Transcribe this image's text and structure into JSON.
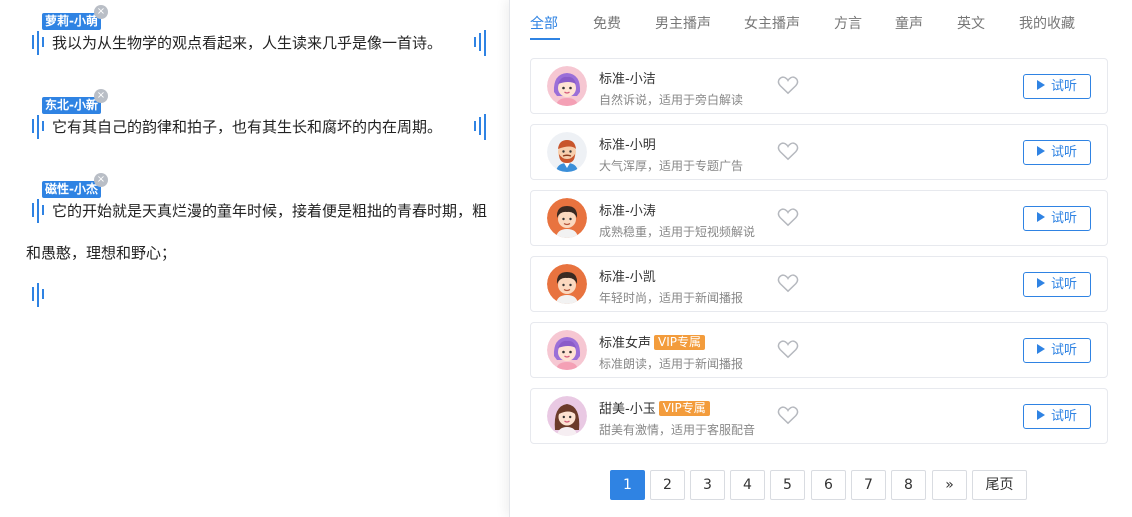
{
  "editor": {
    "paragraphs": [
      {
        "voice_tag": "萝莉-小萌",
        "text": "我以为从生物学的观点看起来，人生读来几乎是像一首诗。"
      },
      {
        "voice_tag": "东北-小新",
        "text": "它有其自己的韵律和拍子，也有其生长和腐坏的内在周期。"
      },
      {
        "voice_tag": "磁性-小杰",
        "text": "它的开始就是天真烂漫的童年时候，接着便是粗拙的青春时期，粗"
      }
    ],
    "continuation": "和愚憨，理想和野心；",
    "remove_glyph": "×"
  },
  "voice_panel": {
    "tabs": [
      {
        "label": "全部",
        "active": true
      },
      {
        "label": "免费"
      },
      {
        "label": "男主播声"
      },
      {
        "label": "女主播声"
      },
      {
        "label": "方言"
      },
      {
        "label": "童声"
      },
      {
        "label": "英文"
      },
      {
        "label": "我的收藏"
      }
    ],
    "try_label": "试听",
    "voices": [
      {
        "name": "标准-小洁",
        "desc": "自然诉说，适用于旁白解读",
        "avatar": "girl-avatar",
        "badge": ""
      },
      {
        "name": "标准-小明",
        "desc": "大气浑厚，适用于专题广告",
        "avatar": "bearded-man-avatar",
        "badge": ""
      },
      {
        "name": "标准-小涛",
        "desc": "成熟稳重，适用于短视频解说",
        "avatar": "man-avatar",
        "badge": ""
      },
      {
        "name": "标准-小凯",
        "desc": "年轻时尚，适用于新闻播报",
        "avatar": "man-avatar",
        "badge": ""
      },
      {
        "name": "标准女声",
        "desc": "标准朗读，适用于新闻播报",
        "avatar": "girl-avatar",
        "badge": "VIP专属"
      },
      {
        "name": "甜美-小玉",
        "desc": "甜美有激情，适用于客服配音",
        "avatar": "woman-avatar",
        "badge": "VIP专属"
      }
    ],
    "pagination": {
      "pages": [
        "1",
        "2",
        "3",
        "4",
        "5",
        "6",
        "7",
        "8"
      ],
      "current": "1",
      "next": "»",
      "last": "尾页"
    }
  },
  "colors": {
    "accent": "#2f83e3",
    "vip_badge": "#f39c3c",
    "tab_inactive": "#777777"
  }
}
